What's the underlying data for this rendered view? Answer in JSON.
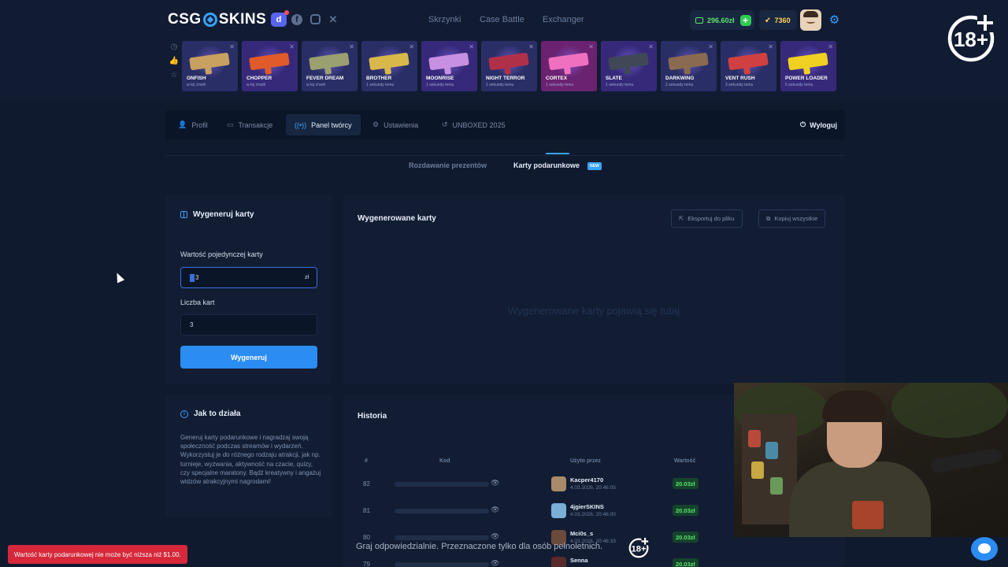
{
  "header": {
    "logo_left": "CSG",
    "logo_right": "SKINS",
    "social": [
      "discord-icon",
      "facebook-icon",
      "instagram-icon",
      "x-icon"
    ],
    "nav": [
      "Skrzynki",
      "Case Battle",
      "Exchanger"
    ],
    "balance": "296.60zł",
    "points": "7360",
    "age_badge": "18+"
  },
  "cases": [
    {
      "name": "ONFISH",
      "sub": "w tej chwili",
      "color": "#c8a060"
    },
    {
      "name": "CHOPPER",
      "sub": "w tej chwili",
      "color": "#e05a2a"
    },
    {
      "name": "FEVER DREAM",
      "sub": "w tej chwili",
      "color": "#9aa070"
    },
    {
      "name": "BROTHER",
      "sub": "1 sekundy temu",
      "color": "#d8b84a"
    },
    {
      "name": "MOONRISE",
      "sub": "1 sekundy temu",
      "color": "#c890e0"
    },
    {
      "name": "NIGHT TERROR",
      "sub": "1 sekundy temu",
      "color": "#b0304a"
    },
    {
      "name": "CORTEX",
      "sub": "1 sekundy temu",
      "color": "#f070c0"
    },
    {
      "name": "SLATE",
      "sub": "1 sekundy temu",
      "color": "#404858"
    },
    {
      "name": "DARKWING",
      "sub": "2 sekundy temu",
      "color": "#8a6a50"
    },
    {
      "name": "VENT RUSH",
      "sub": "3 sekundy temu",
      "color": "#d04040"
    },
    {
      "name": "POWER LOADER",
      "sub": "5 sekundy temu",
      "color": "#f0d020"
    }
  ],
  "account_tabs": [
    "Profil",
    "Transakcje",
    "Panel twórcy",
    "Ustawienia",
    "UNBOXED 2025"
  ],
  "logout": "Wyloguj",
  "sub_tabs": [
    "Rozdawanie prezentów",
    "Karty podarunkowe"
  ],
  "new_badge": "NEW",
  "generator": {
    "title": "Wygeneruj karty",
    "value_label": "Wartość pojedynczej karty",
    "value": "3",
    "currency": "zł",
    "count_label": "Liczba kart",
    "count": "3",
    "button": "Wygeneruj"
  },
  "how": {
    "title": "Jak to działa",
    "text": "Generuj karty podarunkowe i nagradzaj swoją społeczność podczas streamów i wydarzeń. Wykorzystuj je do różnego rodzaju atrakcji, jak np. turnieje, wyzwania, aktywność na czacie, quizy, czy specjalne maratony. Bądź kreatywny i angażuj widzów atrakcyjnymi nagrodami!"
  },
  "generated": {
    "title": "Wygenerowane karty",
    "export": "Eksportuj do pliku",
    "copy_all": "Kopiuj wszystkie",
    "empty": "Wygenerowane karty pojawią się tutaj"
  },
  "history": {
    "title": "Historia",
    "columns": [
      "#",
      "Kod",
      "Użyto przez",
      "Wartość"
    ],
    "rows": [
      {
        "num": "82",
        "user": "Kacper4170",
        "date": "4.03.2026, 20:46:05",
        "value": "20.03zł"
      },
      {
        "num": "81",
        "user": "4jgierSKINS",
        "date": "4.03.2026, 20:46:00",
        "value": "20.03zł"
      },
      {
        "num": "80",
        "user": "Mci0s_s",
        "date": "4.03.2026, 20:46:33",
        "value": "20.03zł"
      },
      {
        "num": "79",
        "user": "Senna",
        "date": "",
        "value": "20.03zł"
      }
    ]
  },
  "toast": "Wartość karty podarunkowej nie może być niższa niż $1.00.",
  "disclaimer": "Graj odpowiedzialnie. Przeznaczone tylko dla osób pełnoletnich."
}
